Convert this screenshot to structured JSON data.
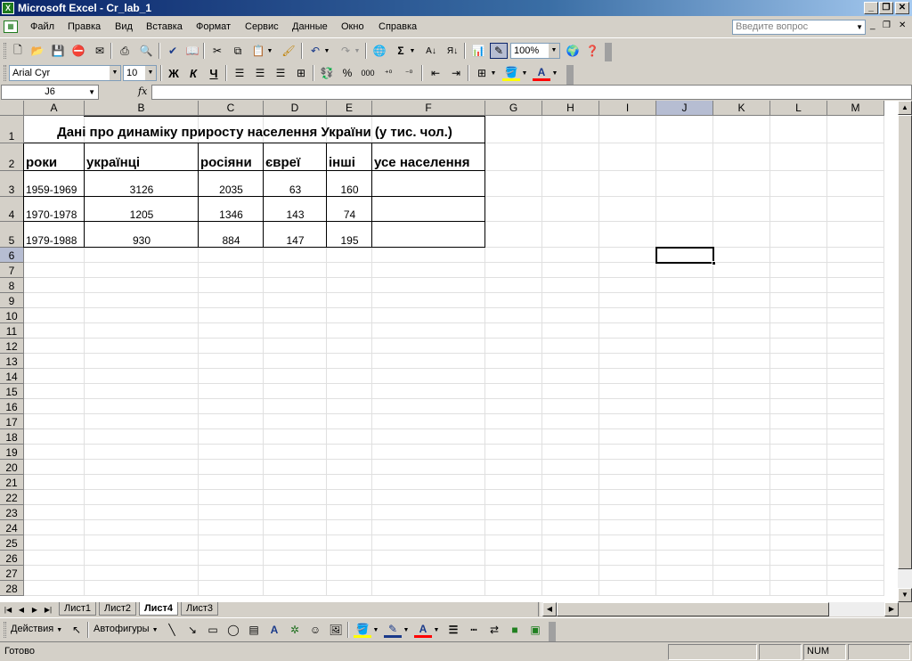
{
  "window": {
    "title": "Microsoft Excel - Cr_lab_1",
    "app_icon": "excel-icon"
  },
  "menu": {
    "items": [
      "Файл",
      "Правка",
      "Вид",
      "Вставка",
      "Формат",
      "Сервис",
      "Данные",
      "Окно",
      "Справка"
    ],
    "ask_placeholder": "Введите вопрос"
  },
  "standard_toolbar": {
    "zoom": "100%"
  },
  "formatting_toolbar": {
    "font": "Arial Cyr",
    "font_size": "10",
    "bold": "Ж",
    "italic": "К",
    "underline": "Ч",
    "percent": "%",
    "thousands": "000"
  },
  "formula_bar": {
    "name_box": "J6",
    "fx": "fx",
    "formula": ""
  },
  "sheet": {
    "columns": [
      "A",
      "B",
      "C",
      "D",
      "E",
      "F",
      "G",
      "H",
      "I",
      "J",
      "K",
      "L",
      "M"
    ],
    "rows": [
      "1",
      "2",
      "3",
      "4",
      "5",
      "6",
      "7",
      "8",
      "9",
      "10",
      "11",
      "12",
      "13",
      "14",
      "15",
      "16",
      "17",
      "18",
      "19",
      "20",
      "21",
      "22",
      "23",
      "24",
      "25",
      "26",
      "27",
      "28"
    ],
    "title": "Дані про динаміку приросту населення України (у тис. чол.)",
    "headers": [
      "роки",
      "українці",
      "росіяни",
      "євреї",
      "інші",
      "усе населення"
    ],
    "data": [
      [
        "1959-1969",
        "3126",
        "2035",
        "63",
        "160",
        ""
      ],
      [
        "1970-1978",
        "1205",
        "1346",
        "143",
        "74",
        ""
      ],
      [
        "1979-1988",
        "930",
        "884",
        "147",
        "195",
        ""
      ]
    ],
    "active_cell": "J6"
  },
  "sheet_tabs": [
    "Лист1",
    "Лист2",
    "Лист4",
    "Лист3"
  ],
  "active_tab": "Лист4",
  "drawing_toolbar": {
    "actions": "Действия",
    "autoshapes": "Автофигуры"
  },
  "status": {
    "ready": "Готово",
    "num": "NUM"
  },
  "colors": {
    "titlebar": "#0a246a",
    "chrome": "#d4d0c8",
    "selected_header": "#b6bdd2"
  }
}
